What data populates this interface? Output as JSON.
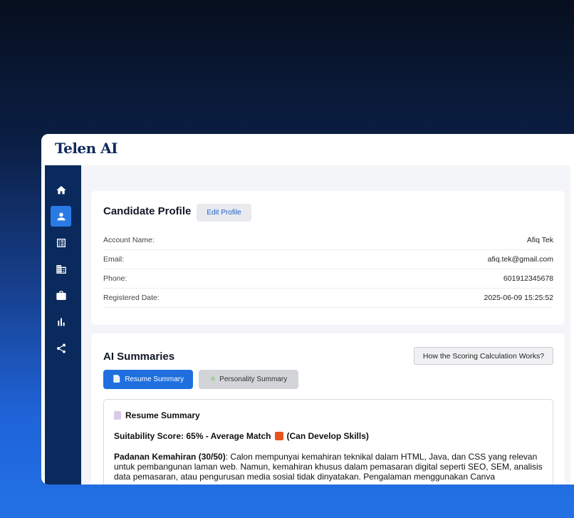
{
  "app": {
    "logo": "Telen AI"
  },
  "sidebar": {
    "items": [
      {
        "name": "home",
        "icon": "home-icon"
      },
      {
        "name": "profile",
        "icon": "person-icon",
        "active": true
      },
      {
        "name": "list",
        "icon": "list-icon"
      },
      {
        "name": "company",
        "icon": "building-icon"
      },
      {
        "name": "jobs",
        "icon": "briefcase-icon"
      },
      {
        "name": "analytics",
        "icon": "bar-chart-icon"
      },
      {
        "name": "share",
        "icon": "share-icon"
      }
    ]
  },
  "profile": {
    "title": "Candidate Profile",
    "edit_label": "Edit Profile",
    "fields": [
      {
        "label": "Account Name:",
        "value": "Afiq Tek"
      },
      {
        "label": "Email:",
        "value": "afiq.tek@gmail.com"
      },
      {
        "label": "Phone:",
        "value": "601912345678"
      },
      {
        "label": "Registered Date:",
        "value": "2025-06-09 15:25:52"
      }
    ]
  },
  "summaries": {
    "title": "AI Summaries",
    "how_label": "How the Scoring Calculation Works?",
    "tabs": [
      {
        "label": "Resume Summary",
        "active": true
      },
      {
        "label": "Personality Summary",
        "active": false
      }
    ],
    "box": {
      "heading": "Resume Summary",
      "score_text": "Suitability Score: 65% - Average Match",
      "score_suffix": "(Can Develop Skills)",
      "score_color": "#e8541f",
      "section_title": "Padanan Kemahiran (30/50)",
      "section_body": ": Calon mempunyai kemahiran teknikal dalam HTML, Java, dan CSS yang relevan untuk pembangunan laman web. Namun, kemahiran khusus dalam pemasaran digital seperti SEO, SEM, analisis data pemasaran, atau pengurusan media sosial tidak dinyatakan. Pengalaman menggunakan Canva"
    }
  },
  "colors": {
    "accent": "#1f6fe0",
    "sidebar": "#0a2a5e",
    "logo": "#0e2a5c"
  }
}
